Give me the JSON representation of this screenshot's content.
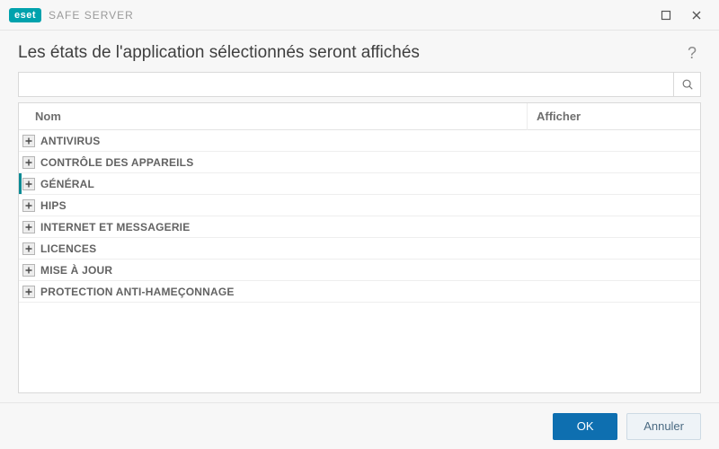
{
  "brand": {
    "badge": "eset",
    "product": "SAFE SERVER"
  },
  "header": {
    "title": "Les états de l'application sélectionnés seront affichés"
  },
  "search": {
    "value": "",
    "placeholder": ""
  },
  "table": {
    "columns": {
      "name": "Nom",
      "show": "Afficher"
    },
    "rows": [
      {
        "label": "ANTIVIRUS",
        "selected": false
      },
      {
        "label": "CONTRÔLE DES APPAREILS",
        "selected": false
      },
      {
        "label": "GÉNÉRAL",
        "selected": true
      },
      {
        "label": "HIPS",
        "selected": false
      },
      {
        "label": "INTERNET ET MESSAGERIE",
        "selected": false
      },
      {
        "label": "LICENCES",
        "selected": false
      },
      {
        "label": "MISE À JOUR",
        "selected": false
      },
      {
        "label": "PROTECTION ANTI-HAMEÇONNAGE",
        "selected": false
      }
    ]
  },
  "footer": {
    "ok": "OK",
    "cancel": "Annuler"
  },
  "help": {
    "symbol": "?"
  },
  "colors": {
    "accent": "#0a8a94",
    "primary": "#0e6fb0"
  }
}
